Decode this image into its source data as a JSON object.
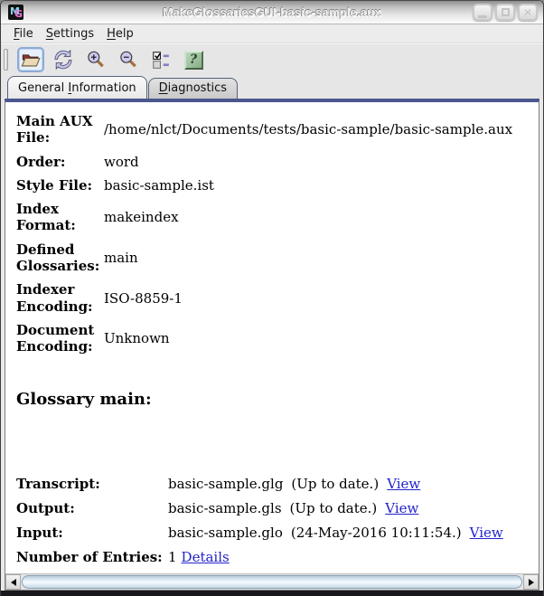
{
  "window": {
    "title": "MakeGlossariesGUI-basic-sample.aux",
    "icon_letters": {
      "m": "M",
      "g": "G"
    },
    "controls": [
      "minimize",
      "maximize",
      "close"
    ],
    "close_glyph": "✕"
  },
  "menu": {
    "items": [
      {
        "mn": "F",
        "rest": "ile"
      },
      {
        "mn": "S",
        "rest": "ettings"
      },
      {
        "mn": "H",
        "rest": "elp"
      }
    ]
  },
  "toolbar": {
    "icons": [
      "open-file-icon",
      "reload-icon",
      "zoom-in-icon",
      "zoom-out-icon",
      "settings-icon",
      "help-icon"
    ],
    "help_glyph": "?"
  },
  "tabs": [
    {
      "pre": "General ",
      "mn": "I",
      "rest": "nformation",
      "selected": true
    },
    {
      "pre": "",
      "mn": "D",
      "rest": "iagnostics",
      "selected": false
    }
  ],
  "general": {
    "fields": [
      {
        "label": "Main AUX File:",
        "value": "/home/nlct/Documents/tests/basic-sample/basic-sample.aux"
      },
      {
        "label": "Order:",
        "value": "word"
      },
      {
        "label": "Style File:",
        "value": "basic-sample.ist"
      },
      {
        "label": "Index Format:",
        "value": "makeindex"
      },
      {
        "label": "Defined Glossaries:",
        "value": "main"
      },
      {
        "label": "Indexer Encoding:",
        "value": "ISO-8859-1"
      },
      {
        "label": "Document Encoding:",
        "value": "Unknown"
      }
    ],
    "glossary_heading": "Glossary main:",
    "files": [
      {
        "label": "Transcript:",
        "file": "basic-sample.glg",
        "status": "(Up to date.)",
        "link": "View"
      },
      {
        "label": "Output:",
        "file": "basic-sample.gls",
        "status": "(Up to date.)",
        "link": "View"
      },
      {
        "label": "Input:",
        "file": "basic-sample.glo",
        "status": "(24-May-2016 10:11:54.)",
        "link": "View"
      }
    ],
    "entries": {
      "label": "Number of Entries:",
      "value": "1",
      "link": "Details"
    }
  },
  "colors": {
    "link": "#2222cc",
    "tab_strip": "#4a568e",
    "help_green": "#86ad86",
    "focus_border": "#8cabd6"
  }
}
